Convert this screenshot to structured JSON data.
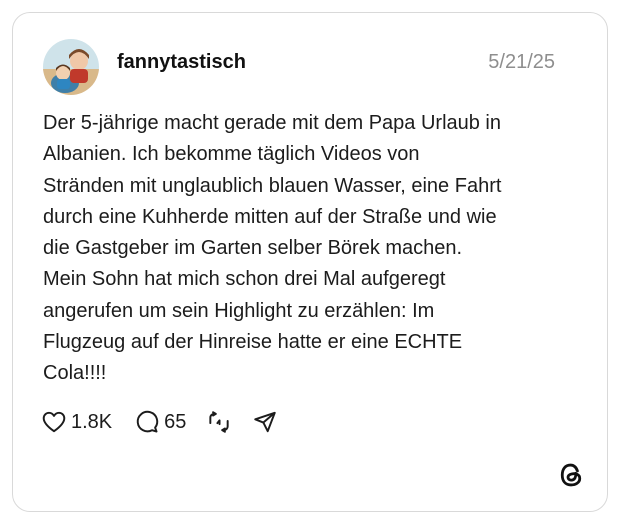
{
  "post": {
    "username": "fannytastisch",
    "date": "5/21/25",
    "lines": [
      "Der 5-jährige macht gerade mit dem Papa Urlaub in",
      "Albanien. Ich bekomme täglich Videos von",
      "Stränden mit unglaublich blauen Wasser, eine Fahrt",
      "durch eine Kuhherde mitten auf der Straße und wie",
      "die Gastgeber im Garten selber Börek machen.",
      "Mein Sohn hat mich schon drei Mal aufgeregt",
      "angerufen um sein Highlight zu erzählen: Im",
      "Flugzeug auf der Hinreise hatte er eine ECHTE",
      "Cola!!!!"
    ]
  },
  "actions": {
    "likes": "1.8K",
    "replies": "65",
    "like_icon": "heart-icon",
    "reply_icon": "comment-bubble-icon",
    "repost_icon": "repost-icon",
    "share_icon": "send-icon"
  },
  "brand": {
    "logo_icon": "threads-logo-icon"
  }
}
